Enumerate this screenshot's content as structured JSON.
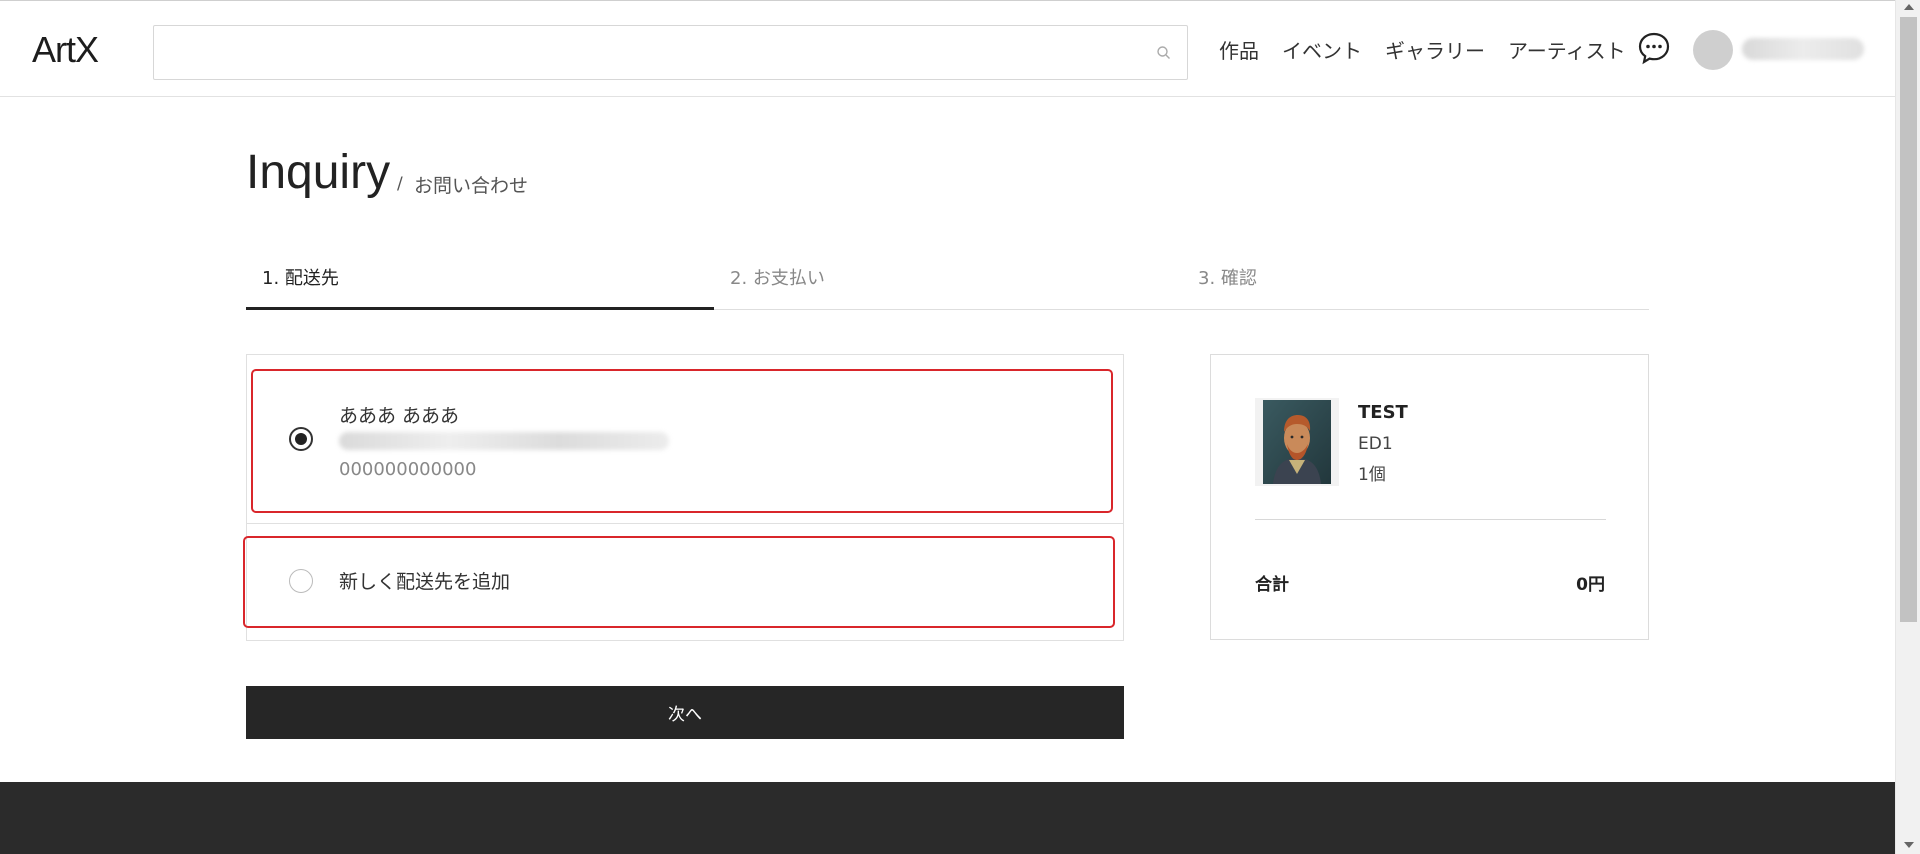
{
  "header": {
    "logo": "ArtX",
    "search": {
      "value": "",
      "placeholder": ""
    },
    "nav": [
      "作品",
      "イベント",
      "ギャラリー",
      "アーティスト"
    ],
    "icons": {
      "search": "search-icon",
      "chat": "chat-bubble-icon"
    }
  },
  "page": {
    "title": "Inquiry",
    "separator": "/",
    "subtitle": "お問い合わせ"
  },
  "steps": [
    {
      "label": "1. 配送先",
      "active": true
    },
    {
      "label": "2. お支払い",
      "active": false
    },
    {
      "label": "3. 確認",
      "active": false
    }
  ],
  "addresses": {
    "existing": {
      "name": "あああ あああ",
      "phone": "000000000000",
      "selected": true
    },
    "add_new": {
      "label": "新しく配送先を追加",
      "selected": false
    }
  },
  "next_button": "次へ",
  "summary": {
    "item": {
      "title": "TEST",
      "edition": "ED1",
      "quantity": "1個"
    },
    "total_label": "合計",
    "total_value": "0円"
  },
  "colors": {
    "highlight": "#d9262b",
    "button_bg": "#262626",
    "footer_bg": "#2b2b2b"
  }
}
